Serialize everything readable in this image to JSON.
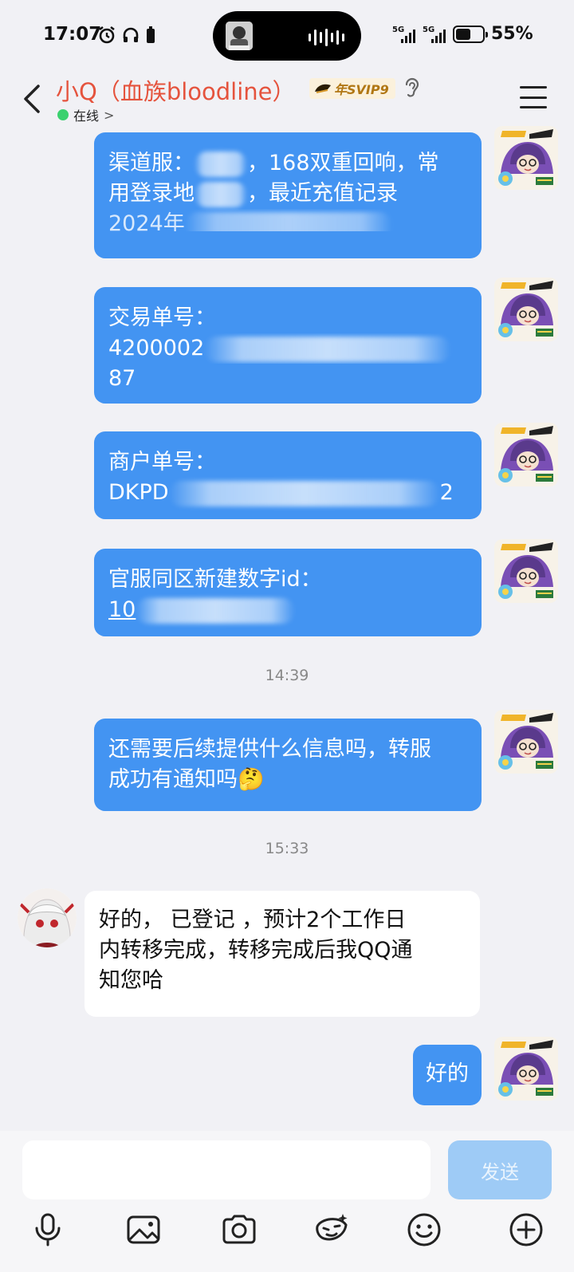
{
  "status": {
    "time": "17:07",
    "net1": "5G",
    "net2": "5G",
    "battery_pct": "55%",
    "battery_level": 0.55
  },
  "header": {
    "title": "小Q（血族bloodline）",
    "vip_badge": "年SVIP9",
    "online_status": "在线",
    "online_arrow": ">"
  },
  "messages": [
    {
      "line1_a": "渠道服：",
      "line1_b": "，168双重回响，常",
      "line2_a": "用登录地",
      "line2_b": "，最近充值记录",
      "line3": "2024年"
    },
    {
      "line1": "交易单号：",
      "line2_a": "4200002",
      "line3": "87"
    },
    {
      "line1": "商户单号：",
      "line2_a": "DKPD",
      "line2_b": "2"
    },
    {
      "line1": "官服同区新建数字id：",
      "line2_a": "10"
    },
    {
      "time": "14:39"
    },
    {
      "line1": "还需要后续提供什么信息吗，转服",
      "line2": "成功有通知吗🤔"
    },
    {
      "time": "15:33"
    },
    {
      "line1": "好的， 已登记 ，预计2个工作日",
      "line2": "内转移完成，转移完成后我QQ通",
      "line3": "知您哈"
    },
    {
      "text": "好的"
    }
  ],
  "input": {
    "placeholder": "",
    "send_label": "发送"
  },
  "toolbar": [
    "mic-icon",
    "image-icon",
    "camera-icon",
    "sticker-icon",
    "emoji-icon",
    "plus-icon"
  ],
  "colors": {
    "accent": "#4394f2",
    "title": "#e5533d",
    "send_disabled": "#9ecbf6"
  }
}
